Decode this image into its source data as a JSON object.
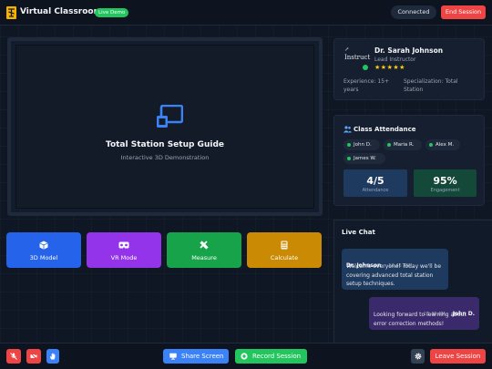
{
  "header": {
    "title": "Virtual Classroom",
    "badge": "Live Demo",
    "status": "Connected",
    "end_session": "End Session"
  },
  "video": {
    "title": "Total Station Setup Guide",
    "subtitle": "Interactive 3D Demonstration"
  },
  "tools": [
    {
      "label": "3D Model",
      "icon": "cube-icon",
      "color": "#2563eb"
    },
    {
      "label": "VR Mode",
      "icon": "vr-headset-icon",
      "color": "#9333ea"
    },
    {
      "label": "Measure",
      "icon": "ruler-pencil-icon",
      "color": "#16a34a"
    },
    {
      "label": "Calculate",
      "icon": "calculator-icon",
      "color": "#ca8a04"
    }
  ],
  "instructor": {
    "avatar_alt": "Instruct",
    "name": "Dr. Sarah Johnson",
    "role": "Lead Instructor",
    "rating": 5,
    "experience": "Experience: 15+ years",
    "specialization": "Specialization: Total Station"
  },
  "attendance": {
    "title": "Class Attendance",
    "students": [
      "John D.",
      "Maria R.",
      "Alex M.",
      "James W."
    ],
    "count": "4/5",
    "count_label": "Attendance",
    "engagement": "95%",
    "engagement_label": "Engagement"
  },
  "chat": {
    "title": "Live Chat",
    "messages": [
      {
        "author": "Dr. Johnson",
        "time": "10:45 AM",
        "text": "Welcome everyone! Today we'll be covering advanced total station setup techniques."
      },
      {
        "author": "John D.",
        "time": "10:46 AM",
        "text": "Looking forward to learning about error correction methods!"
      }
    ]
  },
  "footer": {
    "share_screen": "Share Screen",
    "record_session": "Record Session",
    "leave_session": "Leave Session"
  },
  "colors": {
    "accent_blue": "#2563eb",
    "danger": "#ef4444",
    "success": "#22c55e",
    "brand_yellow": "#f5b301"
  }
}
